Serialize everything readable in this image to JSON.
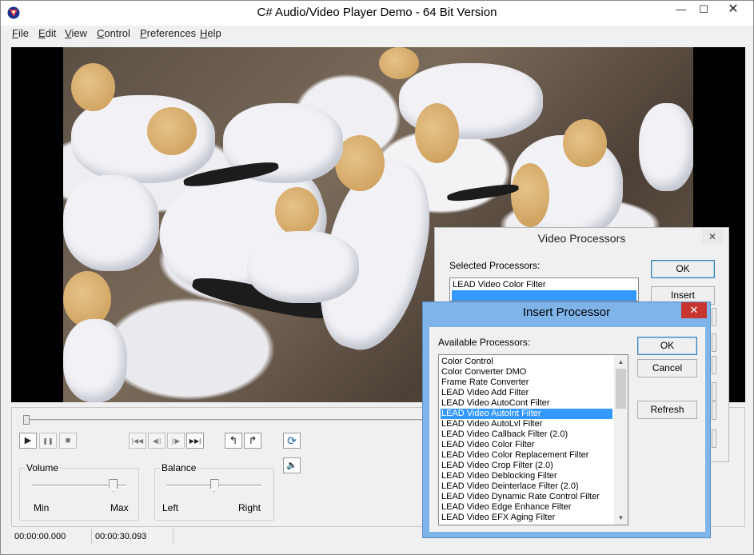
{
  "window": {
    "title": "C# Audio/Video Player Demo - 64 Bit Version",
    "minimize_glyph": "—",
    "maximize_glyph": "☐",
    "close_glyph": "✕"
  },
  "menu": [
    {
      "label": "File",
      "mnemonic": "F",
      "rest": "ile"
    },
    {
      "label": "Edit",
      "mnemonic": "E",
      "rest": "dit"
    },
    {
      "label": "View",
      "mnemonic": "V",
      "rest": "iew"
    },
    {
      "label": "Control",
      "mnemonic": "C",
      "rest": "ontrol"
    },
    {
      "label": "Preferences",
      "mnemonic": "P",
      "rest": "references"
    },
    {
      "label": "Help",
      "mnemonic": "H",
      "rest": "elp"
    }
  ],
  "transport": {
    "play_glyph": "▶",
    "pause_glyph": "❚❚",
    "stop_glyph": "■",
    "seek_start_glyph": "|◀◀",
    "step_back_glyph": "◀||",
    "step_forward_glyph": "||▶",
    "seek_end_glyph": "▶▶|",
    "mark_in_glyph": "↰",
    "mark_out_glyph": "↱",
    "loop_glyph": "⟳",
    "speaker_glyph": "🔈"
  },
  "seek_position": 0.0,
  "volume": {
    "label": "Volume",
    "min_label": "Min",
    "max_label": "Max",
    "level": 0.9
  },
  "balance": {
    "label": "Balance",
    "left_label": "Left",
    "right_label": "Right",
    "level": 0.5
  },
  "status": {
    "position": "00:00:00.000",
    "duration": "00:00:30.093"
  },
  "video_processors_dialog": {
    "title": "Video Processors",
    "close_glyph": "✕",
    "selected_label": "Selected Processors:",
    "selected_items": [
      "LEAD Video Color Filter",
      ""
    ],
    "ok_label": "OK",
    "insert_before_label": "Insert Before..."
  },
  "insert_processor_dialog": {
    "title": "Insert Processor",
    "close_glyph": "✕",
    "available_label": "Available Processors:",
    "ok_label": "OK",
    "cancel_label": "Cancel",
    "refresh_label": "Refresh",
    "items": [
      "Color Control",
      "Color Converter DMO",
      "Frame Rate Converter",
      "LEAD Video Add Filter",
      "LEAD Video AutoCont Filter",
      "LEAD Video AutoInt Filter",
      "LEAD Video AutoLvl Filter",
      "LEAD Video Callback Filter (2.0)",
      "LEAD Video Color Filter",
      "LEAD Video Color Replacement Filter",
      "LEAD Video Crop Filter (2.0)",
      "LEAD Video Deblocking Filter",
      "LEAD Video Deinterlace Filter (2.0)",
      "LEAD Video Dynamic Rate Control Filter",
      "LEAD Video Edge Enhance Filter",
      "LEAD Video EFX Aging Filter"
    ],
    "selected_index": 5
  },
  "colors": {
    "selection": "#3399ff",
    "active_dialog_frame": "#7eb4ea",
    "close_button": "#c7362e"
  }
}
